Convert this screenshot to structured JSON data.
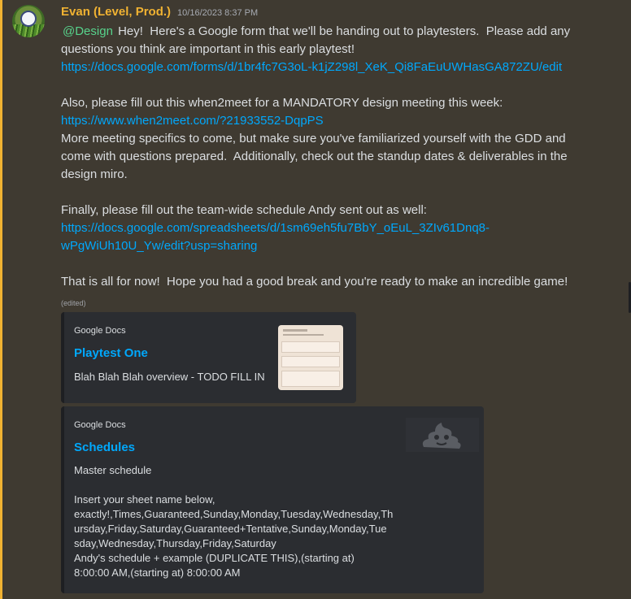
{
  "message": {
    "author": "Evan (Level, Prod.)",
    "timestamp": "10/16/2023 8:37 PM",
    "mention": "@Design",
    "lines": {
      "l1": " Hey!  Here's a Google form that we'll be handing out to playtesters.  Please add any",
      "l2": "questions you think are important in this early playtest!",
      "link1": "https://docs.google.com/forms/d/1br4fc7G3oL-k1jZ298l_XeK_Qi8FaEuUWHasGA872ZU/edit",
      "l4": "Also, please fill out this when2meet for a MANDATORY design meeting this week:",
      "link2": "https://www.when2meet.com/?21933552-DqpPS",
      "l6": "More meeting specifics to come, but make sure you've familiarized yourself with the GDD and",
      "l7": "come with questions prepared.  Additionally, check out the standup dates & deliverables in the",
      "l8": "design miro.",
      "l10": "Finally, please fill out the team-wide schedule Andy sent out as well:",
      "link3a": "https://docs.google.com/spreadsheets/d/1sm69eh5fu7BbY_oEuL_3ZIv61Dnq8-",
      "link3b": "wPgWiUh10U_Yw/edit?usp=sharing",
      "l13": "That is all for now!  Hope you had a good break and you're ready to make an incredible game!"
    },
    "edited": "(edited)"
  },
  "embeds": [
    {
      "provider": "Google Docs",
      "title": "Playtest One",
      "description": "Blah Blah Blah overview - TODO FILL IN"
    },
    {
      "provider": "Google Docs",
      "title": "Schedules",
      "description_lines": [
        "Master schedule",
        "",
        "Insert your sheet name below,",
        "exactly!,Times,Guaranteed,Sunday,Monday,Tuesday,Wednesday,Th",
        "ursday,Friday,Saturday,Guaranteed+Tentative,Sunday,Monday,Tue",
        "sday,Wednesday,Thursday,Friday,Saturday",
        "Andy's schedule + example (DUPLICATE THIS),(starting at)",
        "8:00:00 AM,(starting at) 8:00:00 AM"
      ]
    }
  ],
  "colors": {
    "background": "#3f3a31",
    "author": "#f0b232",
    "link": "#00a8fc",
    "mention": "#57d38c",
    "embed_bg": "#2b2d31"
  }
}
